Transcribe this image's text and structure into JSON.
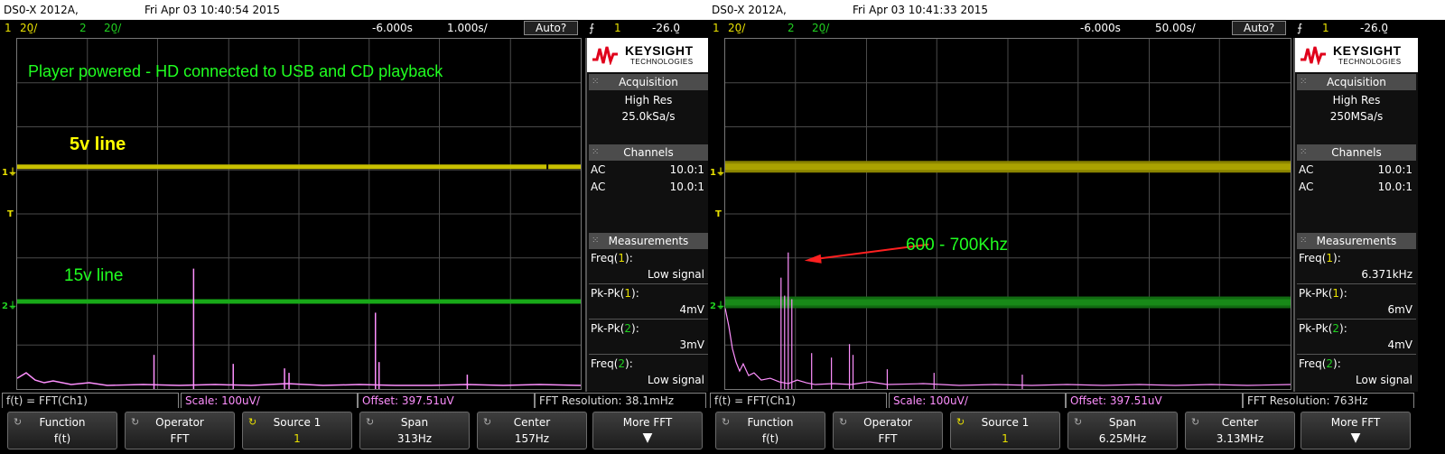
{
  "colors": {
    "ch1": "#e8e000",
    "ch2": "#20d020",
    "fft": "#ff90ff",
    "annotation": "#20ff20",
    "label_5v": "#ffff00",
    "arrow": "#ff2020"
  },
  "left": {
    "model": "DS0-X 2012A,",
    "timestamp": "Fri Apr 03 10:40:54 2015",
    "status": {
      "ch1_num": "1",
      "ch1_scale": "20̱/",
      "ch2_num": "2",
      "ch2_scale": "20̱/",
      "delay": "-6.000s",
      "timebase": "1.000s/",
      "trigger_mode": "Auto?",
      "trig_icon": "⨍",
      "trig_ch": "1",
      "trig_level": "-26.0̱"
    },
    "annotation_title": "Player powered - HD connected to USB and CD playback",
    "label_5v": "5v line",
    "label_15v": "15v line",
    "panel": {
      "brand1": "KEYSIGHT",
      "brand2": "TECHNOLOGIES",
      "acq_header": "Acquisition",
      "acq_mode": "High Res",
      "acq_rate": "25.0kSa/s",
      "channels_header": "Channels",
      "channels": [
        {
          "coupling": "AC",
          "probe": "10.0:1"
        },
        {
          "coupling": "AC",
          "probe": "10.0:1"
        }
      ],
      "meas_header": "Measurements",
      "measurements": [
        {
          "name": "Freq(",
          "ch": "1",
          "close": "):",
          "value": "Low signal"
        },
        {
          "name": "Pk-Pk(",
          "ch": "1",
          "close": "):",
          "value": "4mV"
        },
        {
          "name": "Pk-Pk(",
          "ch": "2",
          "close": "):",
          "value": "3mV"
        },
        {
          "name": "Freq(",
          "ch": "2",
          "close": "):",
          "value": "Low signal"
        }
      ]
    },
    "infobar": {
      "func": "f(t) = FFT(Ch1)",
      "scale": "Scale: 100uV/",
      "offset": "Offset: 397.51uV",
      "resolution": "FFT Resolution: 38.1mHz"
    },
    "softkeys": [
      {
        "label": "Function",
        "value": "f(t)"
      },
      {
        "label": "Operator",
        "value": "FFT"
      },
      {
        "label": "Source 1",
        "value": "1"
      },
      {
        "label": "Span",
        "value": "313Hz"
      },
      {
        "label": "Center",
        "value": "157Hz"
      },
      {
        "label": "More FFT",
        "value": ""
      }
    ]
  },
  "right": {
    "model": "DS0-X 2012A,",
    "timestamp": "Fri Apr 03 10:41:33 2015",
    "status": {
      "ch1_num": "1",
      "ch1_scale": "20̱/",
      "ch2_num": "2",
      "ch2_scale": "20̱/",
      "delay": "-6.000s",
      "timebase": "50.00s/",
      "trigger_mode": "Auto?",
      "trig_icon": "⨍",
      "trig_ch": "1",
      "trig_level": "-26.0̱"
    },
    "annotation_freq": "600 - 700Khz",
    "panel": {
      "brand1": "KEYSIGHT",
      "brand2": "TECHNOLOGIES",
      "acq_header": "Acquisition",
      "acq_mode": "High Res",
      "acq_rate": "250MSa/s",
      "channels_header": "Channels",
      "channels": [
        {
          "coupling": "AC",
          "probe": "10.0:1"
        },
        {
          "coupling": "AC",
          "probe": "10.0:1"
        }
      ],
      "meas_header": "Measurements",
      "measurements": [
        {
          "name": "Freq(",
          "ch": "1",
          "close": "):",
          "value": "6.371kHz"
        },
        {
          "name": "Pk-Pk(",
          "ch": "1",
          "close": "):",
          "value": "6mV"
        },
        {
          "name": "Pk-Pk(",
          "ch": "2",
          "close": "):",
          "value": "4mV"
        },
        {
          "name": "Freq(",
          "ch": "2",
          "close": "):",
          "value": "Low signal"
        }
      ]
    },
    "infobar": {
      "func": "f(t) = FFT(Ch1)",
      "scale": "Scale: 100uV/",
      "offset": "Offset: 397.51uV",
      "resolution": "FFT Resolution: 763Hz"
    },
    "softkeys": [
      {
        "label": "Function",
        "value": "f(t)"
      },
      {
        "label": "Operator",
        "value": "FFT"
      },
      {
        "label": "Source 1",
        "value": "1"
      },
      {
        "label": "Span",
        "value": "6.25MHz"
      },
      {
        "label": "Center",
        "value": "3.13MHz"
      },
      {
        "label": "More FFT",
        "value": ""
      }
    ]
  }
}
